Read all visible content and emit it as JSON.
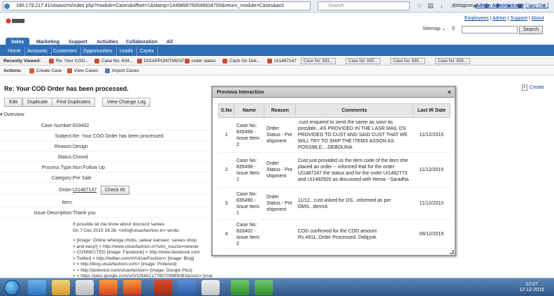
{
  "browser": {
    "url": "180.179.217.41/utsavcrm/index.php?module=Cases&offset=1&stamp=1449899760046634700&return_module=Cases&acti",
    "search_placeholder": "Search"
  },
  "header": {
    "welcome_prefix": "Welcome,",
    "user": "Admin Administrator",
    "logout": "[ Log Out ]",
    "links": [
      "Employees",
      "Admin",
      "Support",
      "About"
    ],
    "sitemap": "Sitemap",
    "search_button": "Search"
  },
  "main_tabs": [
    "Sales",
    "Marketing",
    "Support",
    "Activities",
    "Collaboration",
    "All"
  ],
  "sub_tabs": [
    "Home",
    "Accounts",
    "Customers",
    "Opportunities",
    "Leads",
    "Cases"
  ],
  "recently_viewed": {
    "label": "Recently Viewed:",
    "items": [
      "Re: Your COD...",
      "Case No: 834...",
      "DISAPPOINTMENT",
      "order status",
      "Cash On Deli...",
      "UI1487147",
      "Case No: 833...",
      "Case No: 835...",
      "Case No: 835...",
      "Case No: 835..."
    ]
  },
  "actions": {
    "label": "Actions:",
    "items": [
      "Create Case",
      "View Cases",
      "Import Cases"
    ]
  },
  "page": {
    "title": "Re: Your COD Order has been processed.",
    "create": "Create",
    "buttons": [
      "Edit",
      "Duplicate",
      "Find Duplicates",
      "View Change Log"
    ],
    "overview": "Overview"
  },
  "fields": [
    {
      "label": "Case Number:",
      "value": "833402"
    },
    {
      "label": "Subject:",
      "value": "Re: Your COD Order has been processed."
    },
    {
      "label": "Reason:",
      "value": "Design"
    },
    {
      "label": "Status:",
      "value": "Closed"
    },
    {
      "label": "Process Type:",
      "value": "Non Follow Up"
    },
    {
      "label": "Category:",
      "value": "Pre Sale"
    },
    {
      "label": "Order:",
      "value": "UI1487147"
    },
    {
      "label": "Item:",
      "value": ""
    },
    {
      "label": "Issue Description:",
      "value": "Thank you"
    }
  ],
  "check_ir": "Check IR",
  "mail_lines": [
    "If possible let me know about discount sarees",
    "On 7 Dec 2015 16:28, <info@utsavfashion.in> wrote:",
    "",
    "> [image: Online lehenga cholis, salwar kameez, sarees shop",
    "> and easy!] < http://www.utsavfashion.in?utm_source=newsle",
    "> CONNECTED [image: Facebook] < http://www.facebook.com",
    "> Twitter] < http://twitter.com/#!/UtsavFashion> [image: Blog]",
    "> < http://blog.utsavfashion.com> [image: Pinterest]",
    "> < http://pinterest.com/utsavfashion> [image: Google Plus]",
    "> < https://plus.google.com/u/0/10565217780709965083/posts> [image: New"
  ],
  "modal": {
    "title": "Previous Interaction",
    "close": "×",
    "headers": [
      "S.No",
      "Name",
      "Reason",
      "Comments",
      "Last IR Date"
    ],
    "rows": [
      {
        "sno": "1",
        "name": "Case No: 835498 - Issue Item: 2",
        "reason": "Order Status - Pre shipment",
        "comments": ".cust enquired to send the saree as soon as possible...AS PROVIDED IN THE LASR MAIL OS PROVIDED TO CUST AND SAID CUST THAT WE WILL TRY TO SHIP THE ITEMS ASSON AS POSSIBLE....DEBOLINA",
        "date": "11/12/2015"
      },
      {
        "sno": "2",
        "name": "Case No: 835498 - Issue Item: 1",
        "reason": "Order Status - Pre shipment",
        "comments": "Cust just provided us the item code of the item she placed an order -- informed that for the order UI1487147 the status and for the order UI1482773 and UI1482920 as discussed with Hema --Saradha",
        "date": "11/12/2015"
      },
      {
        "sno": "3",
        "name": "Case No: 835490 - Issue Item: 1",
        "reason": "Order Status - Pre shipment",
        "comments": "11/12...cust asked for OS...informed as per OMS...derrick",
        "date": "11/12/2015"
      },
      {
        "sno": "4",
        "name": "Case No: 833402 - Issue Item: 2",
        "reason": "",
        "comments": "COD confirmed for the COD amount Rs.4911..Order Processed. Debjyoti.",
        "date": "08/12/2015"
      }
    ]
  },
  "taskbar": {
    "time": "12:07",
    "date": "12-12-2015"
  }
}
